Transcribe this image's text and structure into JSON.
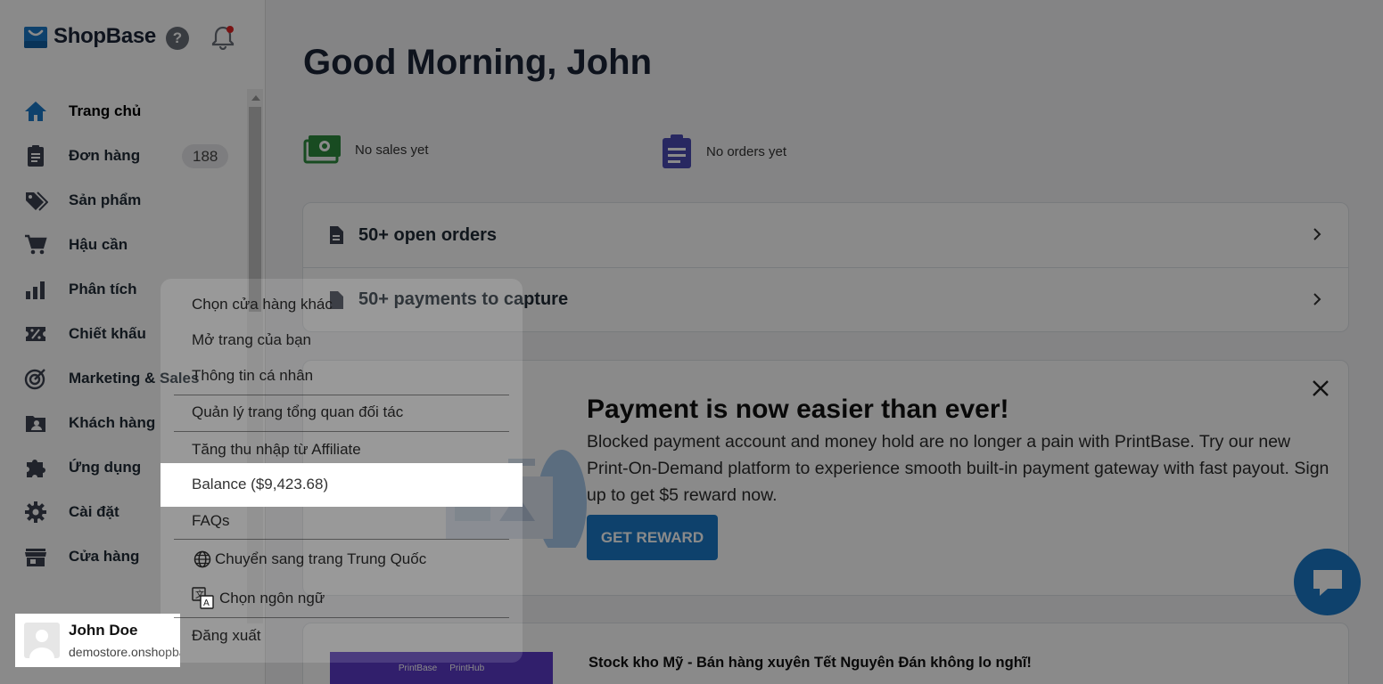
{
  "sidebar": {
    "logo_text": "ShopBase",
    "help_label": "?",
    "nav": [
      {
        "label": "Trang chủ",
        "icon": "home-icon",
        "active": true
      },
      {
        "label": "Đơn hàng",
        "icon": "clipboard-icon",
        "badge": "188"
      },
      {
        "label": "Sản phẩm",
        "icon": "tag-icon"
      },
      {
        "label": "Hậu cần",
        "icon": "cart-icon"
      },
      {
        "label": "Phân tích",
        "icon": "bar-chart-icon"
      },
      {
        "label": "Chiết khấu",
        "icon": "discount-icon"
      },
      {
        "label": "Marketing & Sales",
        "icon": "target-icon"
      },
      {
        "label": "Khách hàng",
        "icon": "contacts-icon"
      },
      {
        "label": "Ứng dụng",
        "icon": "puzzle-icon"
      },
      {
        "label": "Cài đặt",
        "icon": "gear-icon"
      },
      {
        "label": "Cửa hàng",
        "icon": "store-icon"
      }
    ],
    "user": {
      "name": "John Doe",
      "store": "demostore.onshopbase.com"
    }
  },
  "main": {
    "greeting": "Good Morning, John",
    "stats": {
      "sales": "No sales yet",
      "orders": "No orders yet"
    },
    "orders_card": {
      "open_orders": "50+ open orders",
      "payments": "50+ payments to capture"
    },
    "promo": {
      "title": "Payment is now easier than ever!",
      "text": "Blocked payment account and money hold are no longer a pain with PrintBase. Try our new Print-On-Demand platform to experience smooth built-in payment gateway with fast payout. Sign up to get $5 reward now.",
      "button": "GET REWARD"
    },
    "stock": {
      "title": "Stock kho Mỹ - Bán hàng xuyên Tết Nguyên Đán không lo nghĩ!",
      "img_brand_1": "PrintBase",
      "img_brand_2": "PrintHub"
    }
  },
  "user_menu": {
    "items": {
      "switch_store": "Chọn cửa hàng khác",
      "open_store": "Mở trang của bạn",
      "profile": "Thông tin cá nhân",
      "partner_dashboard": "Quản lý trang tổng quan đối tác",
      "affiliate": "Tăng thu nhập từ Affiliate",
      "balance": "Balance ($9,423.68)",
      "faqs": "FAQs",
      "switch_china": "Chuyển sang trang Trung Quốc",
      "language": "Chọn ngôn ngữ",
      "logout": "Đăng xuất"
    }
  },
  "colors": {
    "brand": "#1a79c8",
    "nav_icon": "#3c4250",
    "home_icon": "#1a79c8",
    "sales_icon": "#2e8b3d",
    "orders_icon": "#4a4ab3"
  }
}
